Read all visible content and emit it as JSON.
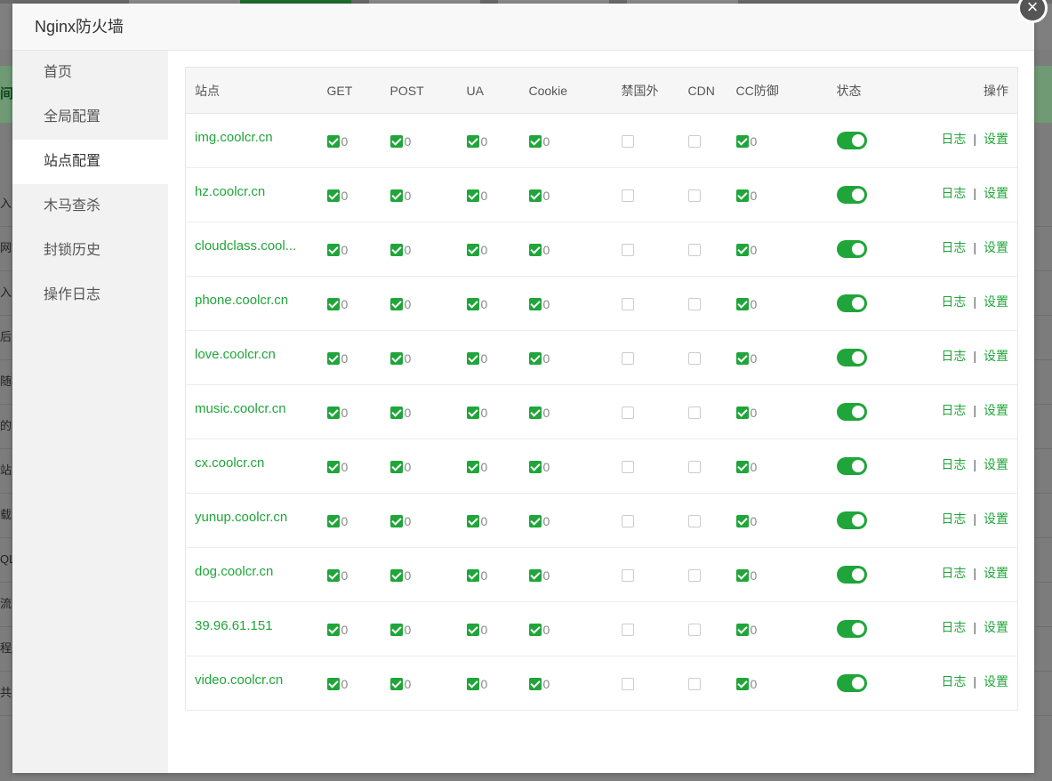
{
  "modal": {
    "title": "Nginx防火墙",
    "close_icon": "×"
  },
  "nav": [
    {
      "label": "首页",
      "active": false
    },
    {
      "label": "全局配置",
      "active": false
    },
    {
      "label": "站点配置",
      "active": true
    },
    {
      "label": "木马查杀",
      "active": false
    },
    {
      "label": "封锁历史",
      "active": false
    },
    {
      "label": "操作日志",
      "active": false
    }
  ],
  "table": {
    "headers": [
      "站点",
      "GET",
      "POST",
      "UA",
      "Cookie",
      "禁国外",
      "CDN",
      "CC防御",
      "状态",
      "操作"
    ],
    "log_label": "日志",
    "settings_label": "设置",
    "separator": "|",
    "rows": [
      {
        "site": "img.coolcr.cn",
        "get": [
          "on",
          "0"
        ],
        "post": [
          "on",
          "0"
        ],
        "ua": [
          "on",
          "0"
        ],
        "cookie": [
          "on",
          "0"
        ],
        "foreign": "off",
        "cdn": "off",
        "cc": [
          "on",
          "0"
        ],
        "status": "on"
      },
      {
        "site": "hz.coolcr.cn",
        "get": [
          "on",
          "0"
        ],
        "post": [
          "on",
          "0"
        ],
        "ua": [
          "on",
          "0"
        ],
        "cookie": [
          "on",
          "0"
        ],
        "foreign": "off",
        "cdn": "off",
        "cc": [
          "on",
          "0"
        ],
        "status": "on"
      },
      {
        "site": "cloudclass.cool...",
        "get": [
          "on",
          "0"
        ],
        "post": [
          "on",
          "0"
        ],
        "ua": [
          "on",
          "0"
        ],
        "cookie": [
          "on",
          "0"
        ],
        "foreign": "off",
        "cdn": "off",
        "cc": [
          "on",
          "0"
        ],
        "status": "on"
      },
      {
        "site": "phone.coolcr.cn",
        "get": [
          "on",
          "0"
        ],
        "post": [
          "on",
          "0"
        ],
        "ua": [
          "on",
          "0"
        ],
        "cookie": [
          "on",
          "0"
        ],
        "foreign": "off",
        "cdn": "off",
        "cc": [
          "on",
          "0"
        ],
        "status": "on"
      },
      {
        "site": "love.coolcr.cn",
        "get": [
          "on",
          "0"
        ],
        "post": [
          "on",
          "0"
        ],
        "ua": [
          "on",
          "0"
        ],
        "cookie": [
          "on",
          "0"
        ],
        "foreign": "off",
        "cdn": "off",
        "cc": [
          "on",
          "0"
        ],
        "status": "on"
      },
      {
        "site": "music.coolcr.cn",
        "get": [
          "on",
          "0"
        ],
        "post": [
          "on",
          "0"
        ],
        "ua": [
          "on",
          "0"
        ],
        "cookie": [
          "on",
          "0"
        ],
        "foreign": "off",
        "cdn": "off",
        "cc": [
          "on",
          "0"
        ],
        "status": "on"
      },
      {
        "site": "cx.coolcr.cn",
        "get": [
          "on",
          "0"
        ],
        "post": [
          "on",
          "0"
        ],
        "ua": [
          "on",
          "0"
        ],
        "cookie": [
          "on",
          "0"
        ],
        "foreign": "off",
        "cdn": "off",
        "cc": [
          "on",
          "0"
        ],
        "status": "on"
      },
      {
        "site": "yunup.coolcr.cn",
        "get": [
          "on",
          "0"
        ],
        "post": [
          "on",
          "0"
        ],
        "ua": [
          "on",
          "0"
        ],
        "cookie": [
          "on",
          "0"
        ],
        "foreign": "off",
        "cdn": "off",
        "cc": [
          "on",
          "0"
        ],
        "status": "on"
      },
      {
        "site": "dog.coolcr.cn",
        "get": [
          "on",
          "0"
        ],
        "post": [
          "on",
          "0"
        ],
        "ua": [
          "on",
          "0"
        ],
        "cookie": [
          "on",
          "0"
        ],
        "foreign": "off",
        "cdn": "off",
        "cc": [
          "on",
          "0"
        ],
        "status": "on"
      },
      {
        "site": "39.96.61.151",
        "get": [
          "on",
          "0"
        ],
        "post": [
          "on",
          "0"
        ],
        "ua": [
          "on",
          "0"
        ],
        "cookie": [
          "on",
          "0"
        ],
        "foreign": "off",
        "cdn": "off",
        "cc": [
          "on",
          "0"
        ],
        "status": "on"
      },
      {
        "site": "video.coolcr.cn",
        "get": [
          "on",
          "0"
        ],
        "post": [
          "on",
          "0"
        ],
        "ua": [
          "on",
          "0"
        ],
        "cookie": [
          "on",
          "0"
        ],
        "foreign": "off",
        "cdn": "off",
        "cc": [
          "on",
          "0"
        ],
        "status": "on"
      }
    ]
  },
  "background": {
    "left_fragments": [
      "间",
      "入",
      "网站",
      "入",
      "后",
      "随机",
      "的",
      "站点",
      "载",
      "QL",
      "流",
      "程序",
      "共用"
    ]
  },
  "colors": {
    "accent": "#20a53a",
    "overlay": "#7f7f7f"
  }
}
